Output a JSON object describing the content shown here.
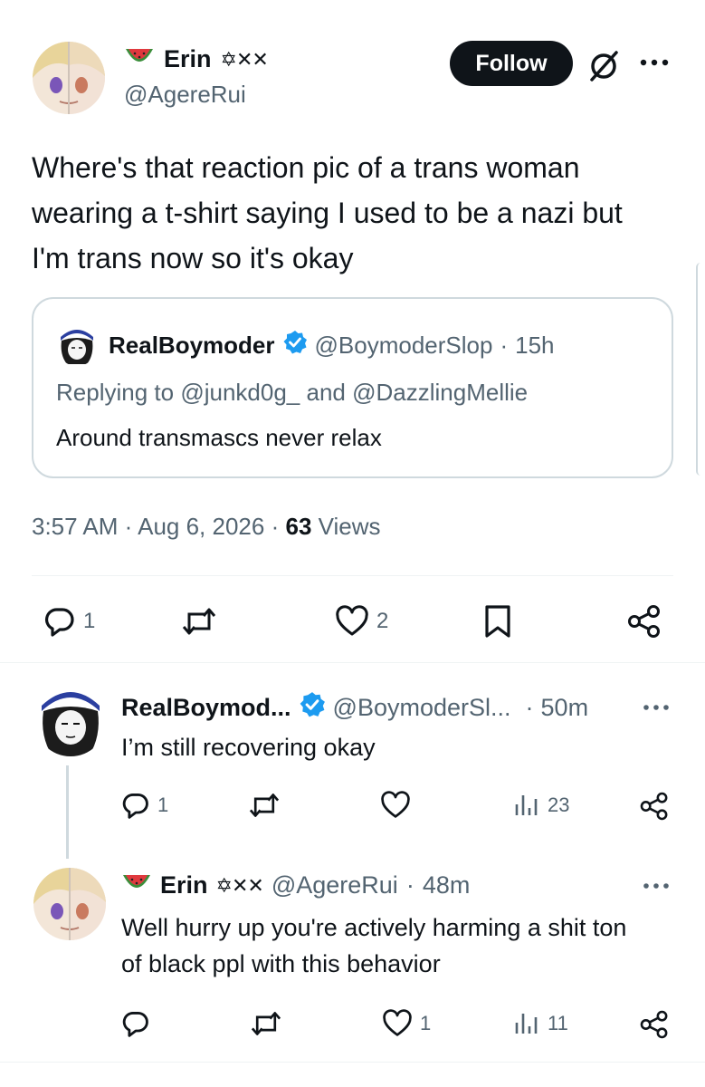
{
  "main_tweet": {
    "author_name": "Erin",
    "author_flair": "✡︎✕✕",
    "handle": "@AgereRui",
    "follow_label": "Follow",
    "text_lines": [
      "Where's that reaction pic of a trans woman",
      "wearing a t-shirt saying I used to be a nazi but",
      "I'm trans now so it's okay"
    ],
    "quote": {
      "author_name": "RealBoymoder",
      "handle": "@BoymoderSlop",
      "sep": "·",
      "time": "15h",
      "replying_prefix": "Replying to",
      "replying_to_1": "@junkd0g_",
      "replying_and": "and",
      "replying_to_2": "@DazzlingMellie",
      "text": "Around transmascs never relax"
    },
    "time": "3:57 AM",
    "sep": "·",
    "date": "Aug 6, 2026",
    "views_count": "63",
    "views_label": "Views",
    "actions": {
      "replies": "1",
      "reposts": "",
      "likes": "2"
    }
  },
  "replies": [
    {
      "author_name": "RealBoymod...",
      "handle": "@BoymoderSl...",
      "sep": "·",
      "time": "50m",
      "text_lines": [
        "I’m still recovering okay"
      ],
      "replies": "1",
      "likes": "",
      "views": "23"
    },
    {
      "author_name": "Erin",
      "author_flair": "✡︎✕✕",
      "handle": "@AgereRui",
      "sep": "·",
      "time": "48m",
      "text_lines": [
        "Well hurry up you're actively harming a shit ton",
        "of black ppl with this behavior"
      ],
      "replies": "",
      "likes": "1",
      "views": "11"
    }
  ],
  "colors": {
    "text": "#0f1419",
    "muted": "#536471",
    "border": "#cfd9de",
    "verified": "#1d9bf0",
    "watermelon_red": "#e0393e",
    "watermelon_green": "#3b8e3b"
  },
  "icons": {
    "more": "more-icon",
    "grok": "grok-icon",
    "reply": "reply-icon",
    "repost": "repost-icon",
    "like": "like-icon",
    "bookmark": "bookmark-icon",
    "share": "share-icon",
    "views": "views-icon",
    "verified": "verified-badge-icon",
    "watermelon": "watermelon-emoji"
  }
}
